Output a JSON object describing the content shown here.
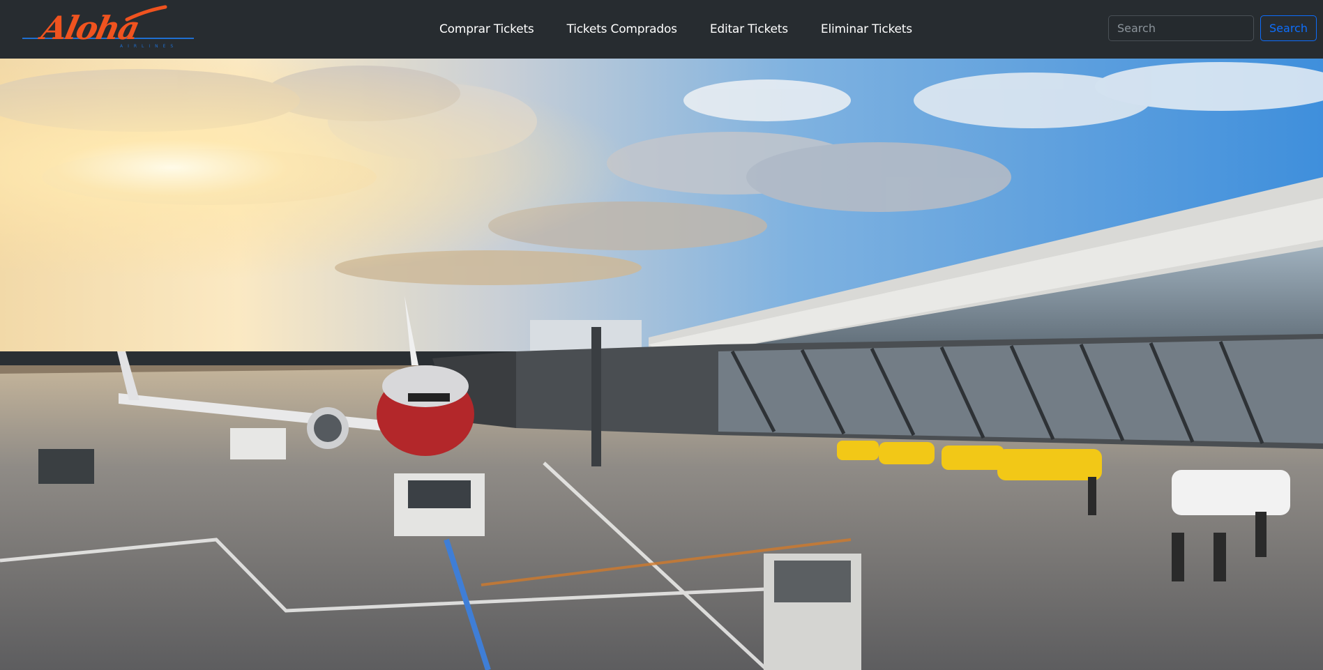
{
  "brand": {
    "logo_text": "Aloha",
    "logo_subtext": "AIRLINES",
    "logo_color": "#f0531f",
    "line_color": "#1f6fd1"
  },
  "nav": {
    "items": [
      {
        "label": "Comprar Tickets"
      },
      {
        "label": "Tickets Comprados"
      },
      {
        "label": "Editar Tickets"
      },
      {
        "label": "Eliminar Tickets"
      }
    ]
  },
  "search": {
    "placeholder": "Search",
    "value": "",
    "button_label": "Search"
  },
  "hero": {
    "image_subject": "airport-apron-sunset-photo"
  },
  "colors": {
    "navbar_bg": "#272c30",
    "accent": "#0d6efd"
  }
}
